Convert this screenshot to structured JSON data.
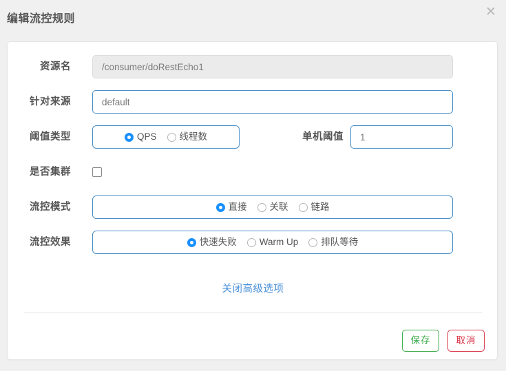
{
  "dialog": {
    "title": "编辑流控规则",
    "close_icon": "close-icon",
    "close_glyph": "✕"
  },
  "form": {
    "resource": {
      "label": "资源名",
      "value": "/consumer/doRestEcho1",
      "disabled": "true"
    },
    "origin": {
      "label": "针对来源",
      "value": "default",
      "placeholder": "default"
    },
    "threshold_type": {
      "label": "阈值类型",
      "options": [
        {
          "label": "QPS",
          "selected": "true"
        },
        {
          "label": "线程数",
          "selected": "false"
        }
      ]
    },
    "single_threshold": {
      "label": "单机阈值",
      "value": "1"
    },
    "cluster": {
      "label": "是否集群",
      "checked": "false"
    },
    "flow_mode": {
      "label": "流控模式",
      "options": [
        {
          "label": "直接",
          "selected": "true"
        },
        {
          "label": "关联",
          "selected": "false"
        },
        {
          "label": "链路",
          "selected": "false"
        }
      ]
    },
    "flow_effect": {
      "label": "流控效果",
      "options": [
        {
          "label": "快速失败",
          "selected": "true"
        },
        {
          "label": "Warm Up",
          "selected": "false"
        },
        {
          "label": "排队等待",
          "selected": "false"
        }
      ]
    },
    "advanced_link": "关闭高级选项"
  },
  "footer": {
    "save_label": "保存",
    "cancel_label": "取消"
  },
  "colors": {
    "accent": "#1890ff",
    "link": "#4a90d9",
    "save": "#3dab4a",
    "cancel": "#d9384a",
    "background": "#f0f0f0"
  }
}
